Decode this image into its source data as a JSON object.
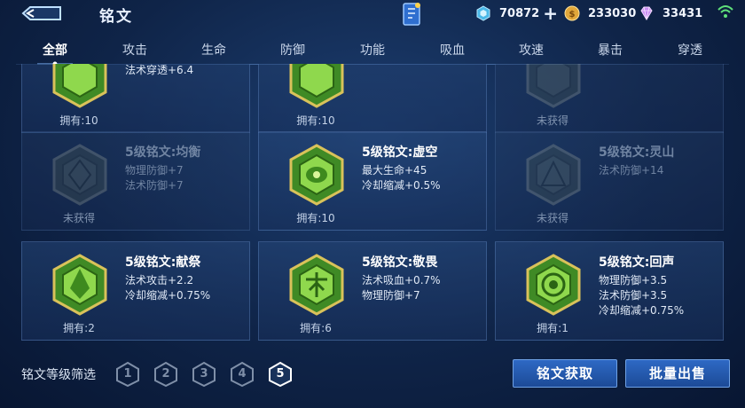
{
  "header": {
    "title": "铭文",
    "back_icon": "back-arrow-icon",
    "resources": [
      {
        "icon": "diamond-icon",
        "value": "70872",
        "has_plus": true
      },
      {
        "icon": "gold-coin-icon",
        "value": "233030",
        "has_plus": false
      },
      {
        "icon": "gem-icon",
        "value": "33431",
        "has_plus": false
      }
    ],
    "plus_label": "+"
  },
  "tabs": [
    {
      "label": "全部",
      "active": true
    },
    {
      "label": "攻击",
      "active": false
    },
    {
      "label": "生命",
      "active": false
    },
    {
      "label": "防御",
      "active": false
    },
    {
      "label": "功能",
      "active": false
    },
    {
      "label": "吸血",
      "active": false
    },
    {
      "label": "攻速",
      "active": false
    },
    {
      "label": "暴击",
      "active": false
    },
    {
      "label": "穿透",
      "active": false
    }
  ],
  "cards": [
    {
      "name": "",
      "stats": [
        "法术穿透+6.4"
      ],
      "owned": "拥有:10",
      "locked": false
    },
    {
      "name": "",
      "stats": [],
      "owned": "拥有:10",
      "locked": false
    },
    {
      "name": "",
      "stats": [],
      "owned": "未获得",
      "locked": true
    },
    {
      "name": "5级铭文:均衡",
      "stats": [
        "物理防御+7",
        "法术防御+7"
      ],
      "owned": "未获得",
      "locked": true
    },
    {
      "name": "5级铭文:虚空",
      "stats": [
        "最大生命+45",
        "冷却缩减+0.5%"
      ],
      "owned": "拥有:10",
      "locked": false
    },
    {
      "name": "5级铭文:灵山",
      "stats": [
        "法术防御+14"
      ],
      "owned": "未获得",
      "locked": true
    },
    {
      "name": "5级铭文:献祭",
      "stats": [
        "法术攻击+2.2",
        "冷却缩减+0.75%"
      ],
      "owned": "拥有:2",
      "locked": false
    },
    {
      "name": "5级铭文:敬畏",
      "stats": [
        "法术吸血+0.7%",
        "物理防御+7"
      ],
      "owned": "拥有:6",
      "locked": false
    },
    {
      "name": "5级铭文:回声",
      "stats": [
        "物理防御+3.5",
        "法术防御+3.5",
        "冷却缩减+0.75%"
      ],
      "owned": "拥有:1",
      "locked": false
    }
  ],
  "footer": {
    "filter_label": "铭文等级筛选",
    "levels": [
      {
        "label": "1",
        "selected": false
      },
      {
        "label": "2",
        "selected": false
      },
      {
        "label": "3",
        "selected": false
      },
      {
        "label": "4",
        "selected": false
      },
      {
        "label": "5",
        "selected": true
      }
    ],
    "get_button": "铭文获取",
    "sell_button": "批量出售"
  },
  "colors": {
    "accent": "#3a78d8",
    "gem_green": "#6fbf3a",
    "gem_gold": "#d9c25a",
    "background": "#12305e"
  }
}
